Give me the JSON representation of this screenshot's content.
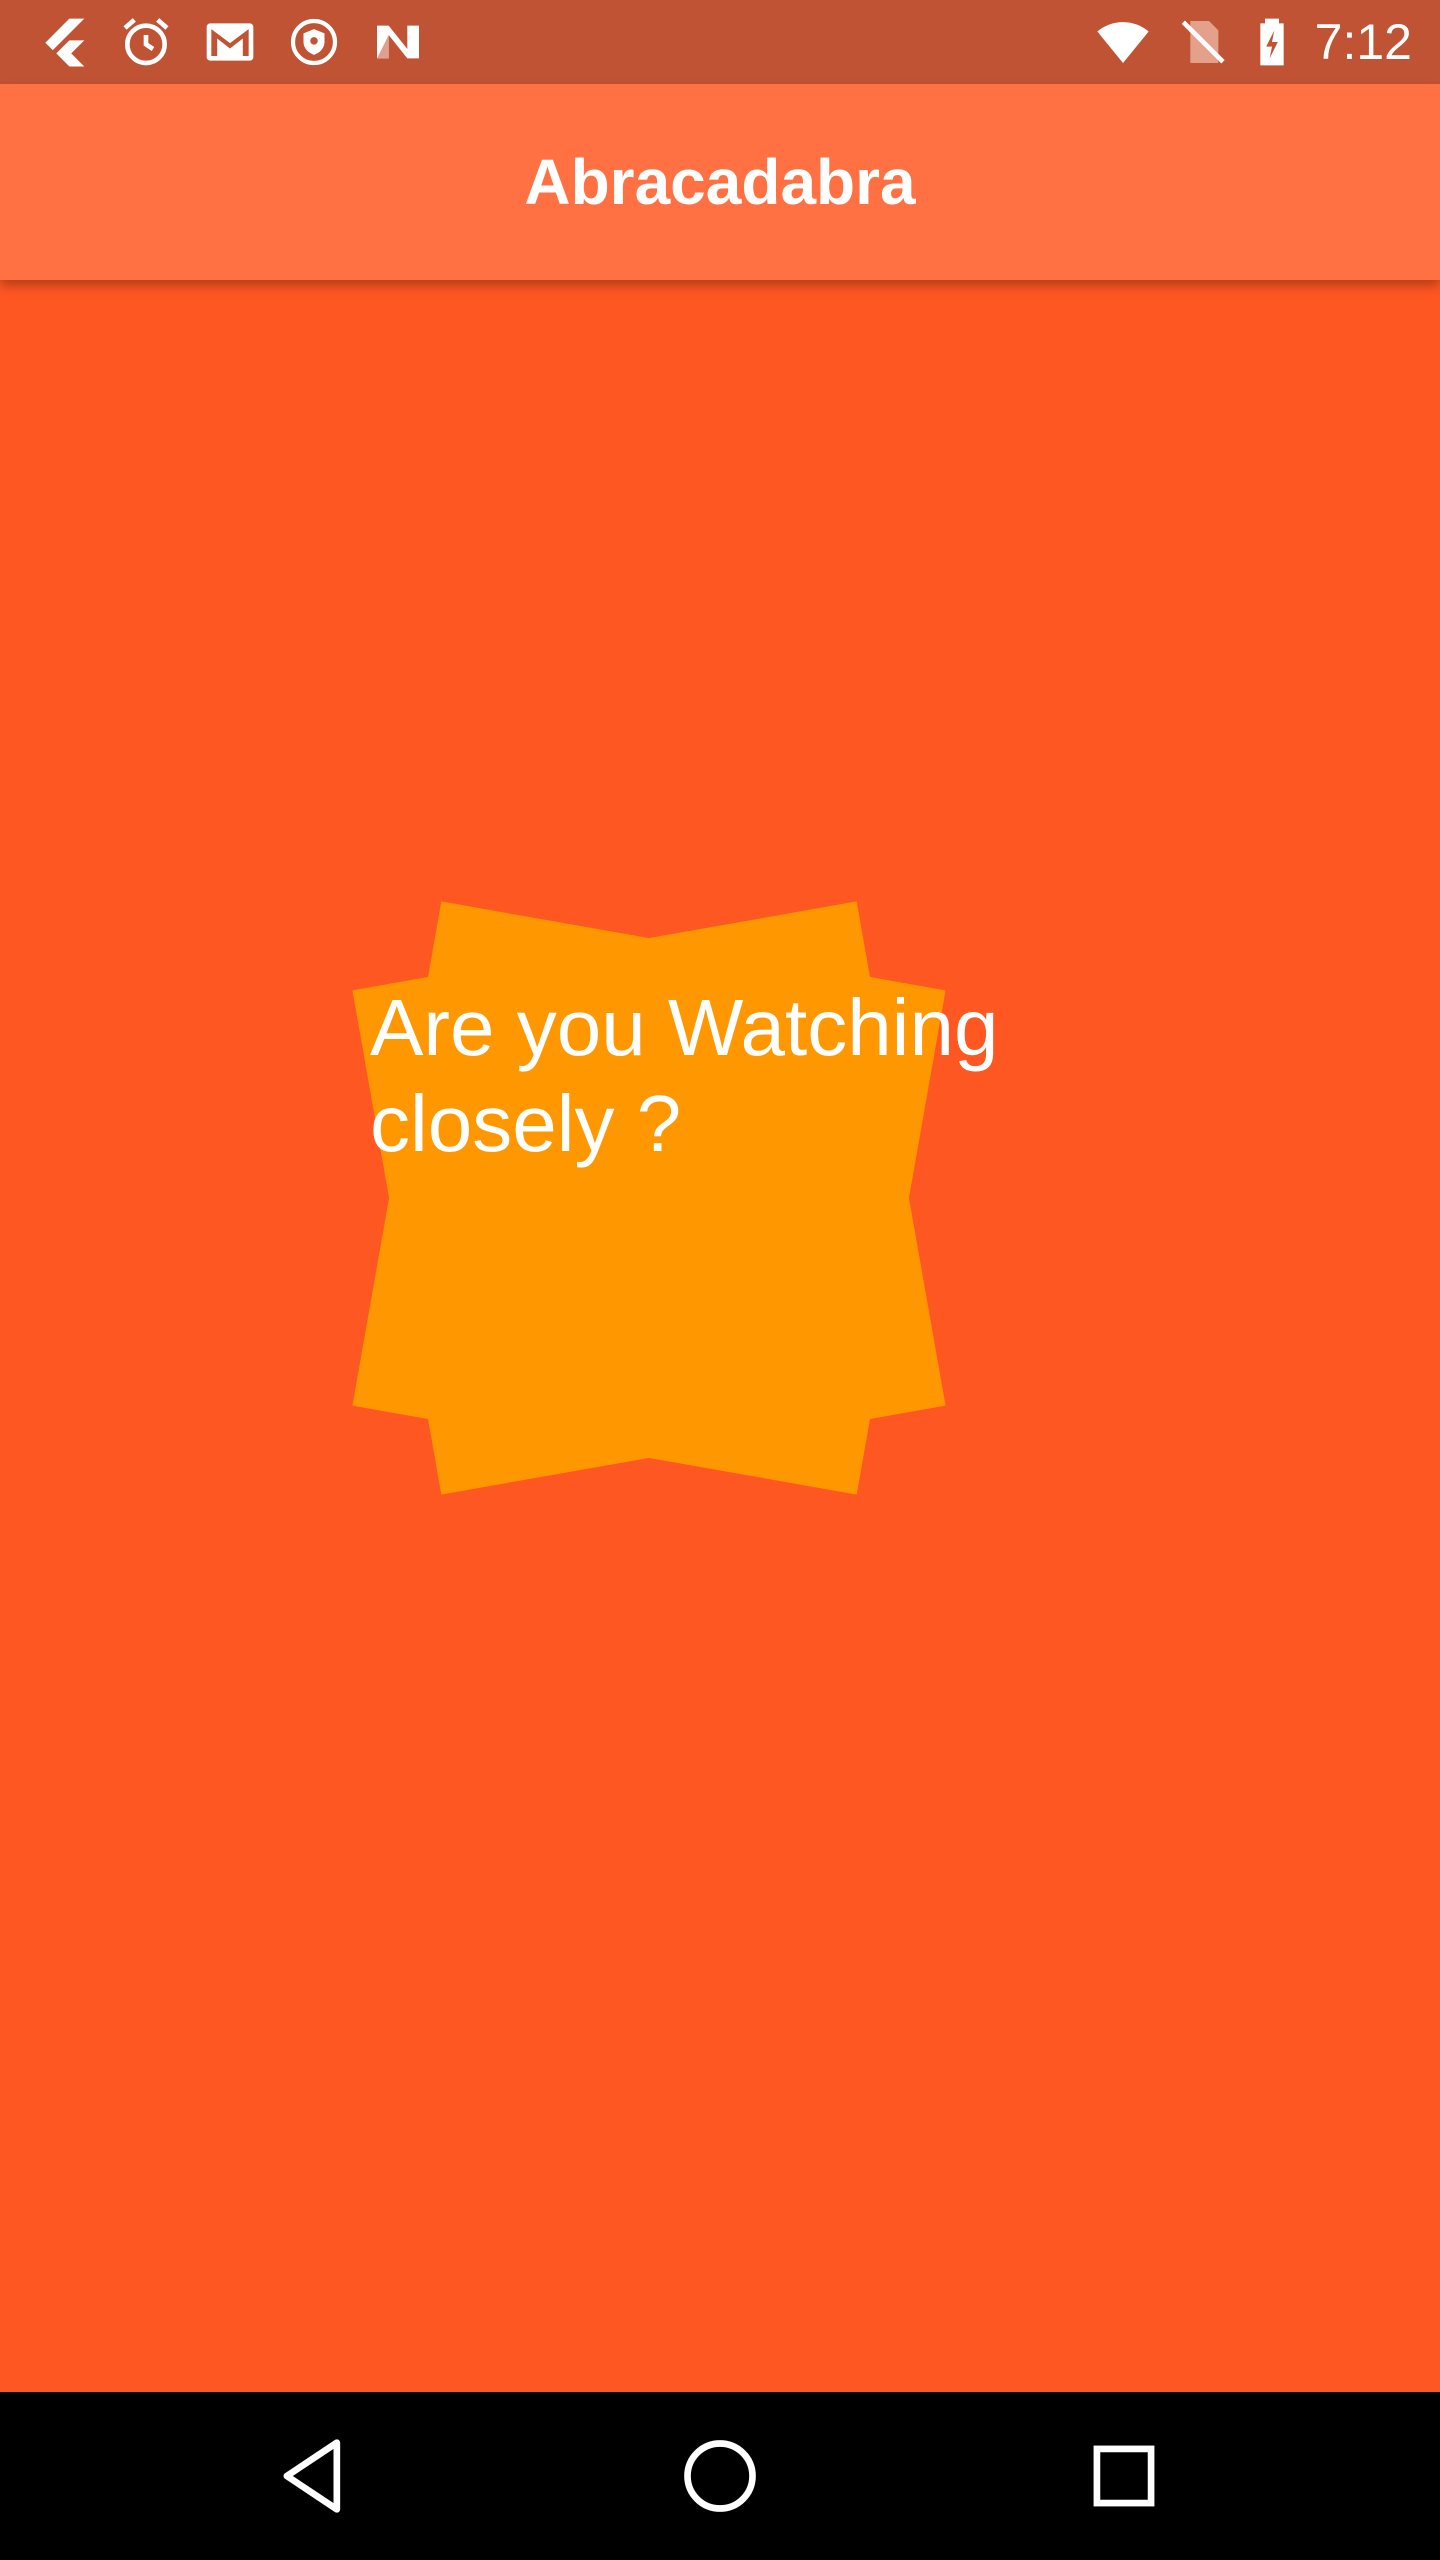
{
  "status_bar": {
    "left_icons": [
      "flutter-icon",
      "alarm-clock-icon",
      "gmail-icon",
      "vpn-shield-icon",
      "n-logo-icon"
    ],
    "right_icons": [
      "wifi-icon",
      "no-sim-icon",
      "battery-charging-icon"
    ],
    "time": "7:12"
  },
  "app_bar": {
    "title": "Abracadabra"
  },
  "content": {
    "message_line1": "Are you Watching",
    "message_line2": "closely ?"
  },
  "nav_bar": {
    "buttons": [
      "back-icon",
      "home-icon",
      "recents-icon"
    ]
  },
  "colors": {
    "status_bar": "#C05333",
    "app_bar": "#FF7043",
    "background": "#FF5722",
    "box": "#FF9800",
    "text": "#FFFFFF",
    "nav_bar": "#000000"
  }
}
